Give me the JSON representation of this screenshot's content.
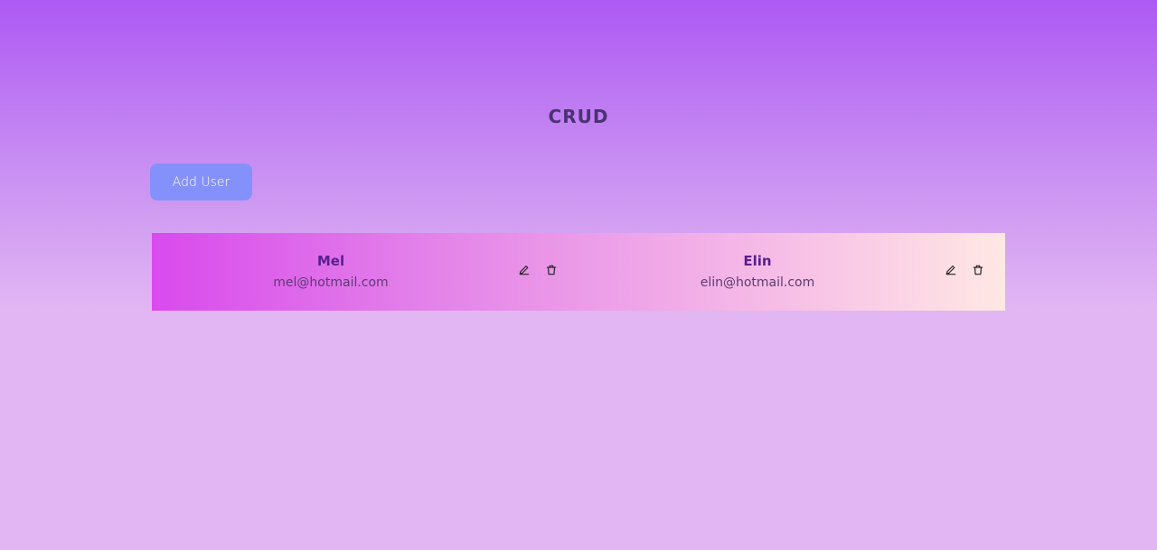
{
  "header": {
    "title": "CRUD"
  },
  "toolbar": {
    "add_user_label": "Add User"
  },
  "users": [
    {
      "name": "Mel",
      "email": "mel@hotmail.com",
      "edit_icon": "pencil-icon",
      "delete_icon": "trash-icon"
    },
    {
      "name": "Elin",
      "email": "elin@hotmail.com",
      "edit_icon": "pencil-icon",
      "delete_icon": "trash-icon"
    }
  ],
  "colors": {
    "title": "#4a3272",
    "button": "#8591fa",
    "name": "#5a1f8e",
    "list_gradient_start": "#d94aed",
    "list_gradient_end": "#ffe8e4"
  }
}
